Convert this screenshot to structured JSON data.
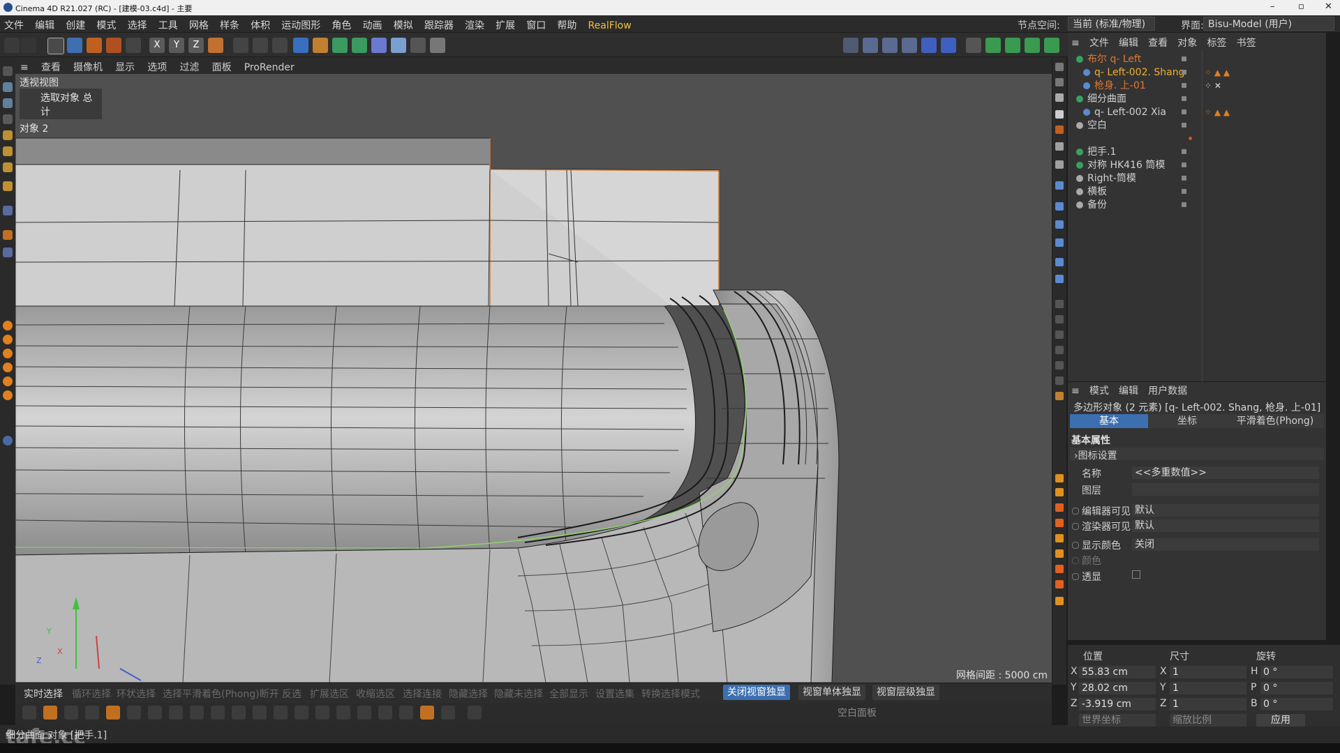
{
  "title_bar": {
    "title": "Cinema 4D R21.027 (RC) - [建模-03.c4d] - 主要",
    "window_controls": [
      "–",
      "▫",
      "✕"
    ]
  },
  "menu": {
    "items": [
      "文件",
      "编辑",
      "创建",
      "模式",
      "选择",
      "工具",
      "网格",
      "样条",
      "体积",
      "运动图形",
      "角色",
      "动画",
      "模拟",
      "跟踪器",
      "渲染",
      "扩展",
      "窗口",
      "帮助",
      "RealFlow"
    ],
    "node_space_label": "节点空间:",
    "node_space_value": "当前 (标准/物理)",
    "layout_label": "界面:",
    "layout_value": "Bisu-Model (用户)"
  },
  "viewport": {
    "menu": [
      "≡",
      "查看",
      "摄像机",
      "显示",
      "选项",
      "过滤",
      "面板",
      "ProRender"
    ],
    "view_name": "透视视图",
    "hud_title": "选取对象 总计",
    "hud_objects": "对象 2",
    "grid_spacing": "网格间距 : 5000 cm"
  },
  "object_manager": {
    "menu": [
      "≡",
      "文件",
      "编辑",
      "查看",
      "对象",
      "标签",
      "书签"
    ],
    "rows": [
      {
        "name": "布尔 q- Left",
        "color": "#e07830"
      },
      {
        "name": "q- Left-002. Shang",
        "color": "#f0b030"
      },
      {
        "name": "枪身. 上-01",
        "color": "#e07830"
      },
      {
        "name": "细分曲面",
        "color": "#d0d0d0"
      },
      {
        "name": "q- Left-002 Xia",
        "color": "#d0d0d0"
      },
      {
        "name": "空白",
        "color": "#d0d0d0"
      },
      {
        "name": "",
        "color": "#d0d0d0"
      },
      {
        "name": "把手.1",
        "color": "#d0d0d0"
      },
      {
        "name": "对称 HK416 筒模",
        "color": "#d0d0d0"
      },
      {
        "name": "Right-筒模",
        "color": "#d0d0d0"
      },
      {
        "name": "横板",
        "color": "#d0d0d0"
      },
      {
        "name": "备份",
        "color": "#d0d0d0"
      }
    ]
  },
  "attributes": {
    "menu": [
      "≡",
      "模式",
      "编辑",
      "用户数据"
    ],
    "title": "多边形对象 (2 元素) [q- Left-002. Shang, 枪身. 上-01]",
    "tabs": [
      "基本",
      "坐标",
      "平滑着色(Phong)"
    ],
    "section": "基本属性",
    "subsection": "›图标设置",
    "fields": [
      {
        "label": "名称",
        "value": "<<多重数值>>"
      },
      {
        "label": "图层",
        "value": ""
      },
      {
        "label": "编辑器可见",
        "value": "默认"
      },
      {
        "label": "渲染器可见",
        "value": "默认"
      },
      {
        "label": "显示颜色",
        "value": "关闭"
      },
      {
        "label": "颜色",
        "value": ""
      },
      {
        "label": "透显",
        "value": ""
      }
    ]
  },
  "coordinates": {
    "headers": [
      "位置",
      "尺寸",
      "旋转"
    ],
    "rows": [
      {
        "pos_axis": "X",
        "pos": "55.83 cm",
        "size_axis": "X",
        "size": "1",
        "rot_axis": "H",
        "rot": "0 °"
      },
      {
        "pos_axis": "Y",
        "pos": "28.02 cm",
        "size_axis": "Y",
        "size": "1",
        "rot_axis": "P",
        "rot": "0 °"
      },
      {
        "pos_axis": "Z",
        "pos": "-3.919 cm",
        "size_axis": "Z",
        "size": "1",
        "rot_axis": "B",
        "rot": "0 °"
      }
    ],
    "mode_left": "世界坐标",
    "mode_right": "缩放比例",
    "apply": "应用"
  },
  "mode_bar": {
    "items": [
      "实时选择",
      "循环选择",
      "环状选择",
      "选择平滑着色(Phong)断开",
      "反选",
      "扩展选区",
      "收缩选区",
      "选择连接",
      "隐藏选择",
      "隐藏未选择",
      "全部显示",
      "设置选集",
      "转换选择模式"
    ],
    "solo_off": "关闭视窗独显",
    "solo_single": "视窗单体独显",
    "solo_hier": "视窗层级独显",
    "empty_panel": "空白面板"
  },
  "status": {
    "text": "细分曲面 对象 [把手.1]",
    "watermark": "tafe.cc"
  }
}
